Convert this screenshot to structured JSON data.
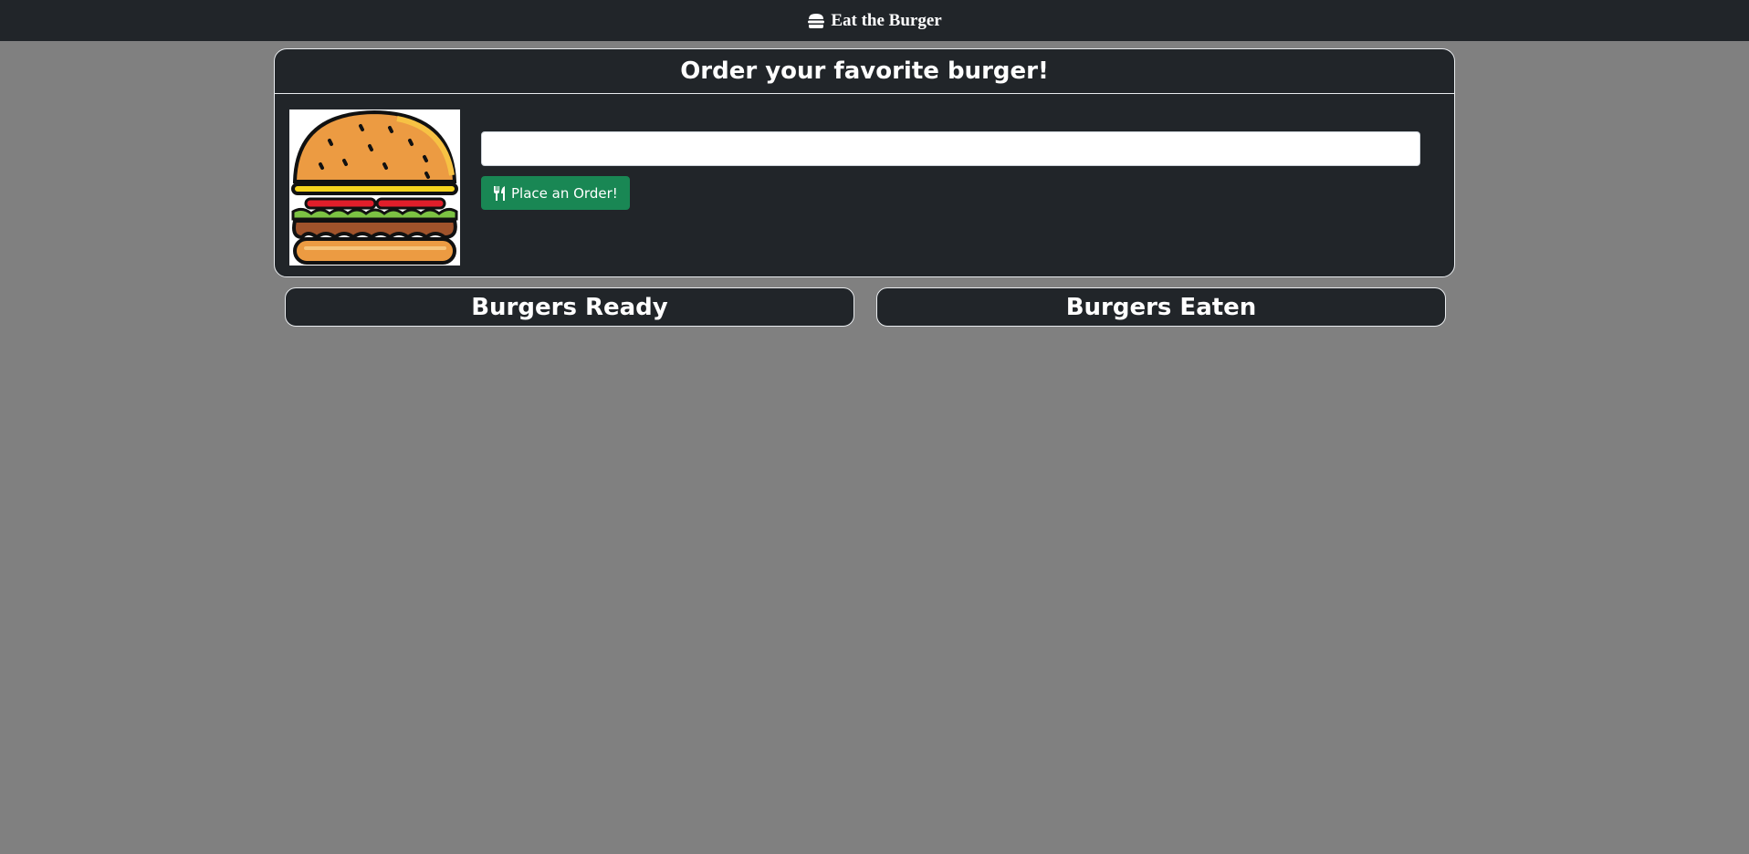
{
  "navbar": {
    "brand_icon": "hamburger-icon",
    "brand_text": "Eat the Burger"
  },
  "order_card": {
    "title": "Order your favorite burger!",
    "image": "burger-illustration",
    "input_value": "",
    "input_placeholder": "",
    "button_icon": "utensils-icon",
    "button_label": "Place an Order!"
  },
  "lists": {
    "ready_title": "Burgers Ready",
    "eaten_title": "Burgers Eaten"
  },
  "colors": {
    "background": "#808080",
    "panel": "#212529",
    "button": "#198754",
    "text": "#ffffff"
  }
}
